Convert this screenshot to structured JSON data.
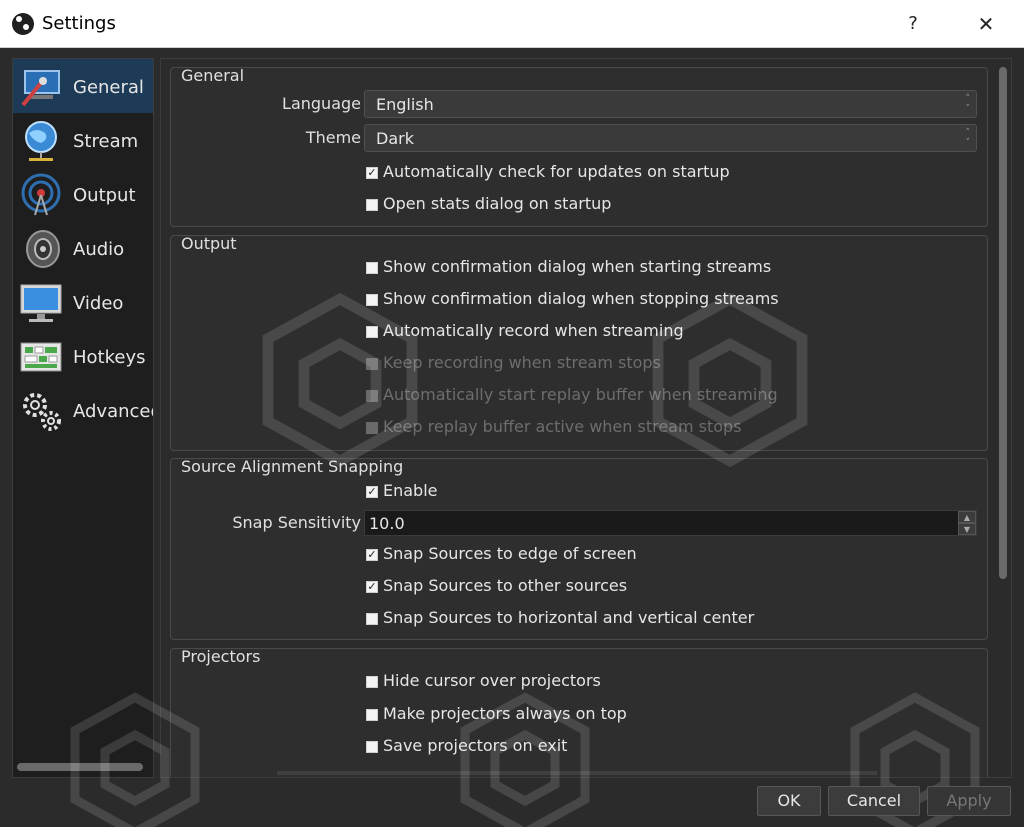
{
  "window": {
    "title": "Settings",
    "help_label": "?",
    "close_label": "✕"
  },
  "sidebar": {
    "items": [
      {
        "label": "General",
        "icon": "general-icon",
        "selected": true
      },
      {
        "label": "Stream",
        "icon": "globe-icon"
      },
      {
        "label": "Output",
        "icon": "output-signal-icon"
      },
      {
        "label": "Audio",
        "icon": "speaker-icon"
      },
      {
        "label": "Video",
        "icon": "monitor-icon"
      },
      {
        "label": "Hotkeys",
        "icon": "keyboard-icon"
      },
      {
        "label": "Advanced",
        "icon": "gears-icon"
      }
    ]
  },
  "general": {
    "title": "General",
    "language_label": "Language",
    "language_value": "English",
    "theme_label": "Theme",
    "theme_value": "Dark",
    "checks": [
      {
        "label": "Automatically check for updates on startup",
        "checked": true
      },
      {
        "label": "Open stats dialog on startup",
        "checked": false
      }
    ]
  },
  "output": {
    "title": "Output",
    "checks": [
      {
        "label": "Show confirmation dialog when starting streams",
        "checked": false,
        "enabled": true
      },
      {
        "label": "Show confirmation dialog when stopping streams",
        "checked": false,
        "enabled": true
      },
      {
        "label": "Automatically record when streaming",
        "checked": false,
        "enabled": true
      },
      {
        "label": "Keep recording when stream stops",
        "checked": false,
        "enabled": false
      },
      {
        "label": "Automatically start replay buffer when streaming",
        "checked": false,
        "enabled": false
      },
      {
        "label": "Keep replay buffer active when stream stops",
        "checked": false,
        "enabled": false
      }
    ]
  },
  "snapping": {
    "title": "Source Alignment Snapping",
    "enable_label": "Enable",
    "enable_checked": true,
    "sensitivity_label": "Snap Sensitivity",
    "sensitivity_value": "10.0",
    "checks": [
      {
        "label": "Snap Sources to edge of screen",
        "checked": true
      },
      {
        "label": "Snap Sources to other sources",
        "checked": true
      },
      {
        "label": "Snap Sources to horizontal and vertical center",
        "checked": false
      }
    ]
  },
  "projectors": {
    "title": "Projectors",
    "checks": [
      {
        "label": "Hide cursor over projectors",
        "checked": false
      },
      {
        "label": "Make projectors always on top",
        "checked": false
      },
      {
        "label": "Save projectors on exit",
        "checked": false
      }
    ]
  },
  "buttons": {
    "ok": "OK",
    "cancel": "Cancel",
    "apply": "Apply"
  },
  "colors": {
    "selected_nav": "#1d3b57",
    "panel_bg": "#2b2b2b",
    "sidebar_bg": "#1e1e1e"
  }
}
